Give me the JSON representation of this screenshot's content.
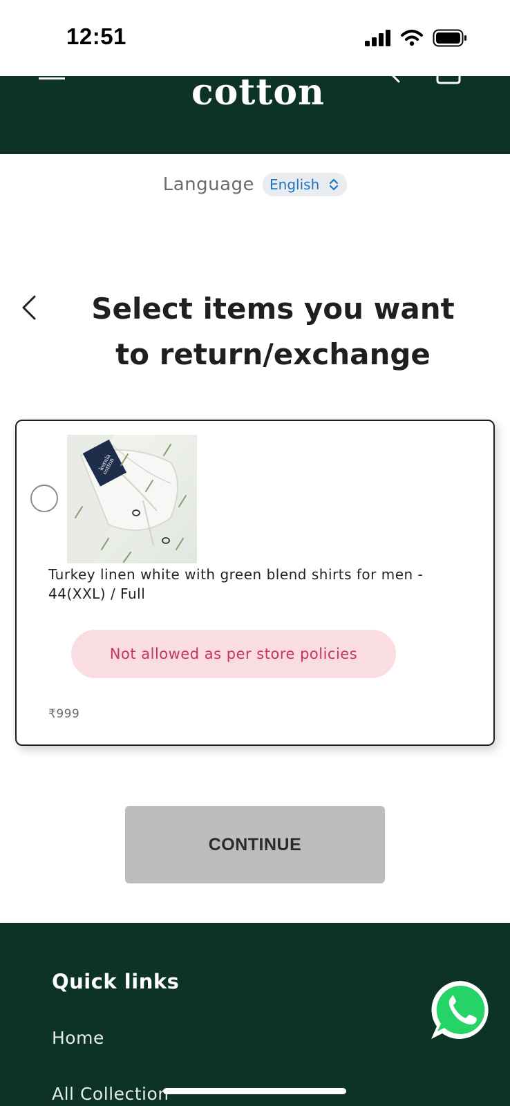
{
  "status_bar": {
    "time": "12:51"
  },
  "header": {
    "logo_text": "cotton",
    "brand_color": "#0c3323"
  },
  "language": {
    "label": "Language",
    "selected": "English"
  },
  "page": {
    "title_line1": "Select items you want",
    "title_line2": "to return/exchange"
  },
  "item": {
    "title": "Turkey linen white with green blend shirts for men - 44(XXL) / Full",
    "policy_message": "Not allowed as per store policies",
    "price": "₹999",
    "selected": false,
    "label_text": "kerala cotton"
  },
  "actions": {
    "continue_label": "CONTINUE"
  },
  "footer": {
    "heading": "Quick links",
    "links": [
      "Home",
      "All Collection"
    ]
  },
  "icons": [
    "menu-icon",
    "search-icon",
    "cart-icon",
    "chevron-updown-icon",
    "back-chevron-icon",
    "whatsapp-icon",
    "signal-icon",
    "wifi-icon",
    "battery-icon"
  ]
}
